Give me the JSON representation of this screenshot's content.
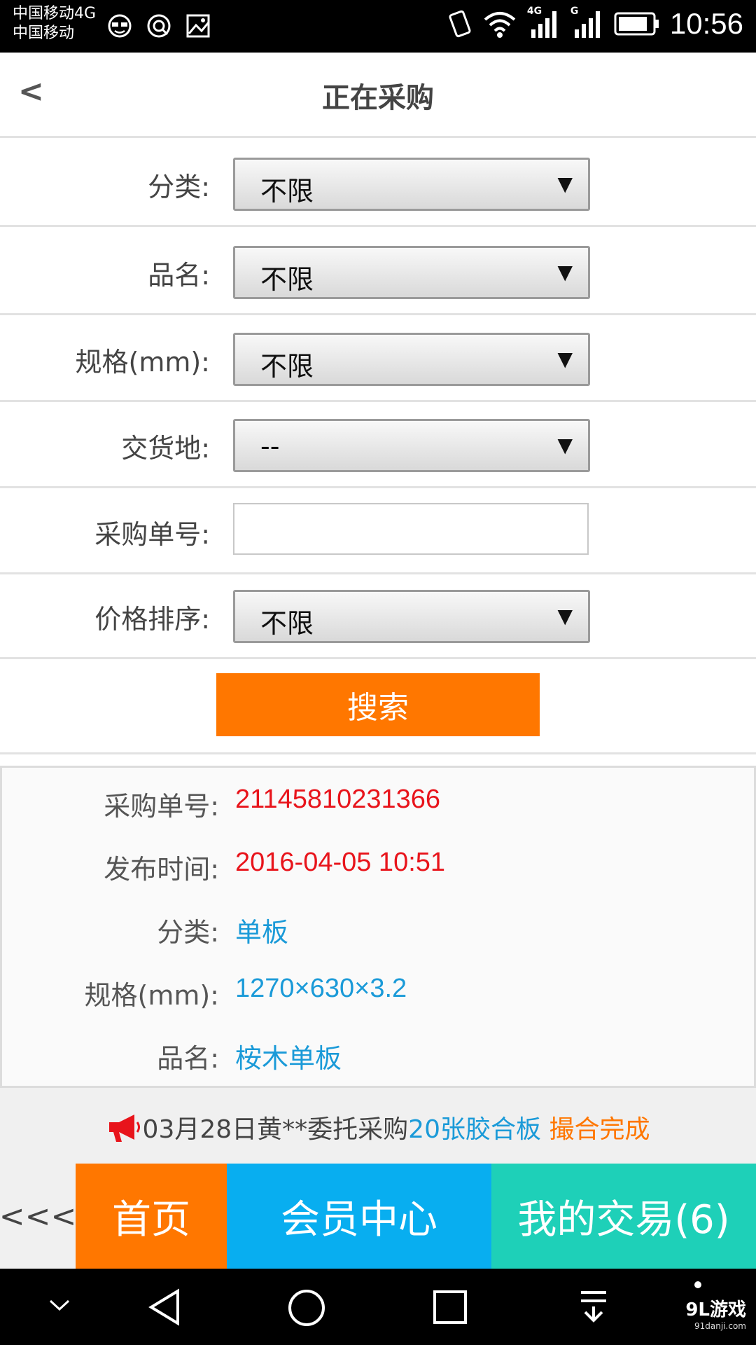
{
  "status_bar": {
    "carrier_line1": "中国移动4G",
    "carrier_line2": "中国移动",
    "time": "10:56",
    "net1": "4G",
    "net2": "G"
  },
  "header": {
    "back": "<",
    "title": "正在采购"
  },
  "filters": {
    "category": {
      "label": "分类:",
      "value": "不限"
    },
    "product": {
      "label": "品名:",
      "value": "不限"
    },
    "spec": {
      "label": "规格(mm):",
      "value": "不限"
    },
    "delivery": {
      "label": "交货地:",
      "value": "--"
    },
    "order_no": {
      "label": "采购单号:",
      "value": ""
    },
    "price_sort": {
      "label": "价格排序:",
      "value": "不限"
    }
  },
  "search_button": "搜索",
  "result": {
    "order_no": {
      "label": "采购单号:",
      "value": "21145810231366"
    },
    "publish_time": {
      "label": "发布时间:",
      "value": "2016-04-05 10:51"
    },
    "category": {
      "label": "分类:",
      "value": "单板"
    },
    "spec": {
      "label": "规格(mm):",
      "value": "1270×630×3.2"
    },
    "product": {
      "label": "品名:",
      "value": "桉木单板"
    }
  },
  "notice": {
    "text": "03月28日黄**委托采购",
    "item": "20张胶合板",
    "status": "撮合完成"
  },
  "bottom_nav": {
    "back": "<<<",
    "home": "首页",
    "member": "会员中心",
    "trade": "我的交易(6)"
  },
  "watermark": {
    "logo": "9L游戏",
    "site": "91danji.com"
  },
  "colors": {
    "orange": "#ff7700",
    "blue": "#08aef0",
    "teal": "#1ed0b8",
    "red": "#e8141b",
    "link_blue": "#1a9ad8"
  }
}
